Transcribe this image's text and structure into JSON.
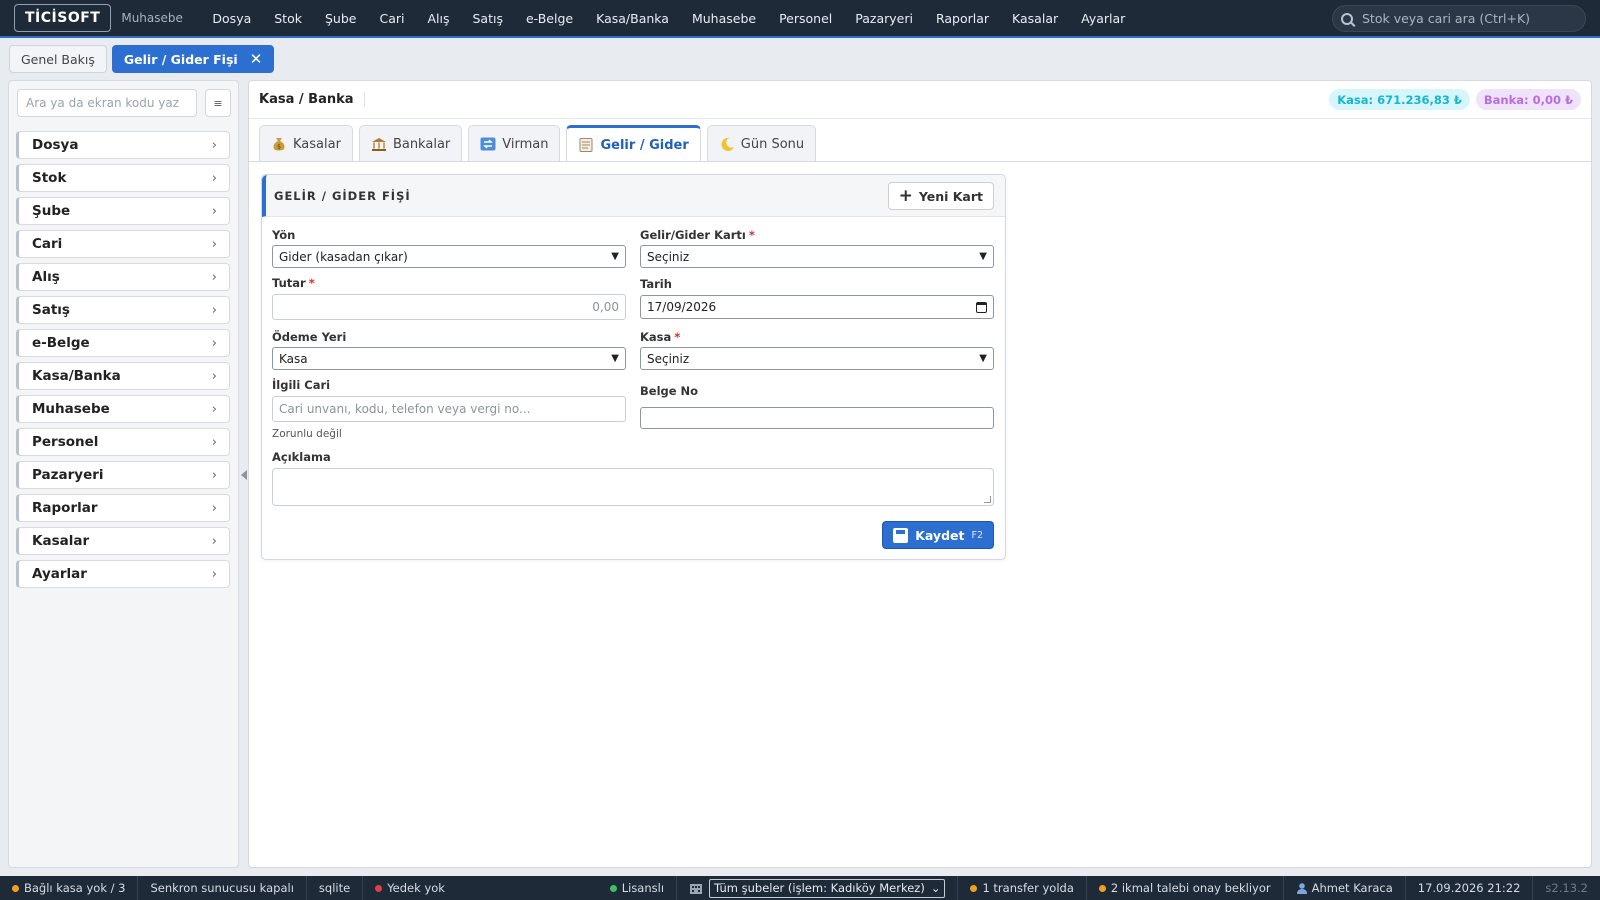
{
  "app": {
    "logo": "TİCİSOFT",
    "module": "Muhasebe",
    "menu": [
      "Dosya",
      "Stok",
      "Şube",
      "Cari",
      "Alış",
      "Satış",
      "e-Belge",
      "Kasa/Banka",
      "Muhasebe",
      "Personel",
      "Pazaryeri",
      "Raporlar",
      "Kasalar",
      "Ayarlar"
    ],
    "search_placeholder": "Stok veya cari ara (Ctrl+K)"
  },
  "page_tabs": [
    {
      "label": "Genel Bakış",
      "active": false
    },
    {
      "label": "Gelir / Gider Fişi",
      "active": true,
      "close": "✕"
    }
  ],
  "sidebar": {
    "search_placeholder": "Ara ya da ekran kodu yaz",
    "grid_icon": "≡",
    "items": [
      "Dosya",
      "Stok",
      "Şube",
      "Cari",
      "Alış",
      "Satış",
      "e-Belge",
      "Kasa/Banka",
      "Muhasebe",
      "Personel",
      "Pazaryeri",
      "Raporlar",
      "Kasalar",
      "Ayarlar"
    ]
  },
  "main": {
    "title": "Kasa / Banka",
    "kasa_badge": "Kasa: 671.236,83 ₺",
    "banka_badge": "Banka: 0,00 ₺",
    "tabs": [
      {
        "label": "Kasalar",
        "icon": "money-bag-icon",
        "active": false
      },
      {
        "label": "Bankalar",
        "icon": "bank-icon",
        "active": false
      },
      {
        "label": "Virman",
        "icon": "transfer-icon",
        "active": false
      },
      {
        "label": "Gelir / Gider",
        "icon": "ledger-icon",
        "active": true
      },
      {
        "label": "Gün Sonu",
        "icon": "moon-icon",
        "active": false
      }
    ]
  },
  "form": {
    "title": "GELİR / GİDER FİŞİ",
    "new_card_button": "Yeni Kart",
    "yon": {
      "label": "Yön",
      "value": "Gider (kasadan çıkar)"
    },
    "kart": {
      "label": "Gelir/Gider Kartı",
      "value": "Seçiniz"
    },
    "tutar": {
      "label": "Tutar",
      "placeholder": "0,00"
    },
    "tarih": {
      "label": "Tarih",
      "value": "17/09/2026"
    },
    "odeme_yeri": {
      "label": "Ödeme Yeri",
      "value": "Kasa"
    },
    "kasa": {
      "label": "Kasa",
      "value": "Seçiniz"
    },
    "ilgili_cari": {
      "label": "İlgili Cari",
      "placeholder": "Cari unvanı, kodu, telefon veya vergi no...",
      "hint": "Zorunlu değil"
    },
    "belge_no": {
      "label": "Belge No",
      "value": ""
    },
    "aciklama": {
      "label": "Açıklama",
      "value": ""
    },
    "required_mark": "*",
    "save_button": "Kaydet",
    "save_shortcut": "F2"
  },
  "statusbar": {
    "kasa": "Bağlı kasa yok / 3",
    "sync": "Senkron sunucusu kapalı",
    "db": "sqlite",
    "backup": "Yedek yok",
    "license": "Lisanslı",
    "branch": "Tüm şubeler (işlem: Kadıköy Merkez)",
    "transfer": "1 transfer yolda",
    "ikmal": "2 ikmal talebi onay bekliyor",
    "user": "Ahmet Karaca",
    "datetime": "17.09.2026 21:22",
    "version": "s2.13.2",
    "colors": {
      "orange": "#f0a020",
      "red": "#e04040",
      "green": "#3cc060"
    }
  }
}
